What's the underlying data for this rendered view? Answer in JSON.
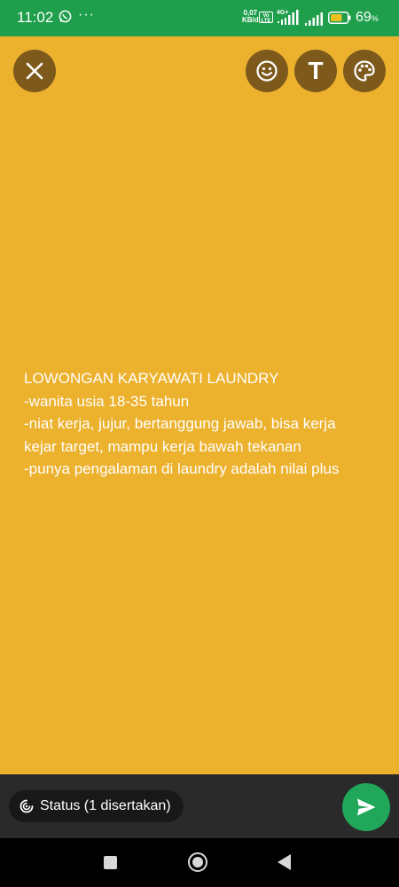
{
  "status_bar": {
    "time": "11:02",
    "overflow_dots": "···",
    "net_speed_value": "0,07",
    "net_speed_unit": "KB/d",
    "volte_label": "Vo LTE",
    "network_type": "4G+",
    "battery_percent": "69",
    "battery_percent_unit": "%",
    "battery_level": 0.69
  },
  "toolbar": {
    "text_tool_label": "T",
    "icons": [
      "close-icon",
      "emoji-icon",
      "text-icon",
      "palette-icon"
    ]
  },
  "status_post": {
    "background_color": "#ecb12d",
    "lines": [
      "LOWONGAN KARYAWATI LAUNDRY",
      "-wanita usia 18-35 tahun",
      "-niat kerja, jujur, bertanggung jawab, bisa kerja",
      "kejar target, mampu kerja bawah tekanan",
      "-punya pengalaman di laundry adalah nilai plus"
    ]
  },
  "bottom_bar": {
    "audience_label": "Status (1 disertakan)",
    "send_icon": "send-icon"
  },
  "nav_bar": {
    "icons": [
      "recents-icon",
      "home-icon",
      "back-icon"
    ]
  }
}
